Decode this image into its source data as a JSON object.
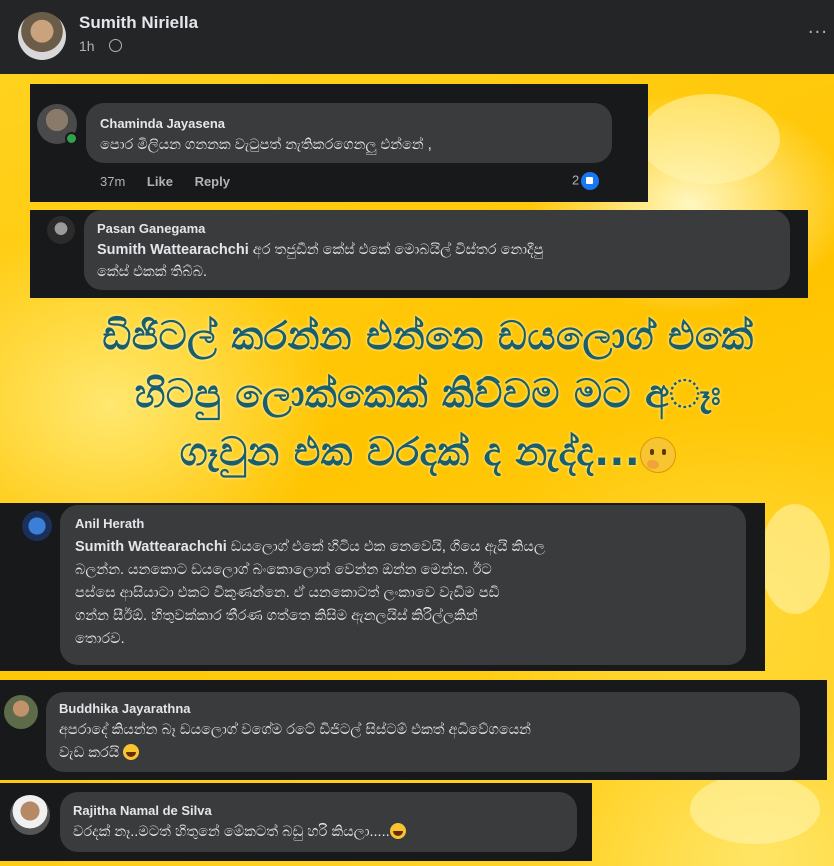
{
  "post": {
    "author": "Sumith Niriella",
    "time": "1h",
    "menu": "···"
  },
  "headline": {
    "line1": "ඩිජිටල් කරන්න එන්නෙ ඩයලොග් එකේ",
    "line2": "හිටපු ලොක්කෙක් කිව්වම මට අෑඃ",
    "line3": "ගෑවුන එක වරදක් ද නැද්ද..."
  },
  "comments": [
    {
      "name": "Chaminda Jayasena",
      "text": "පොර මිලියන ගනනක වැටුපත් නැතිකරගෙනලු එන්නේ ,",
      "time": "37m",
      "like": "Like",
      "reply": "Reply",
      "reactions": "2"
    },
    {
      "name": "Pasan Ganegama",
      "tag": "Sumith Wattearachchi",
      "text_line1": " අර තජුඩීන් කේස් එකේ මොබයිල් විස්තර නොදීපු",
      "text_line2": "කේස් එකක් තිබ්බ."
    },
    {
      "name": "Anil Herath",
      "tag": "Sumith Wattearachchi",
      "text_line1": " ඩයලොග් එකේ හිටිය එක නෙවෙයි, ගියෙ ඇයි කියල",
      "text_line2": "බලන්න. යනකොට ඩයලොග් බංකොලොත් වෙන්න ඔන්න මෙන්න. ඊට",
      "text_line3": "පස්සෙ ආසියාටා එකට විකුණන්නෙ. ඒ යනකොටත් ලංකාවෙ වැඩිම පඩි",
      "text_line4": "ගන්න සීඊඕ. හිතුවක්කාර තීරණ ගත්තෙ කිසිම ඇනලයිස් කිරිල්ලකින්",
      "text_line5": "තොරව."
    },
    {
      "name": "Buddhika Jayarathna",
      "text_line1": "අපරාදේ කියන්න බෑ ඩයලොග් වගේම රටේ ඩිජිටල් සිස්ටම් එකත් අධිවේගයෙන්",
      "text_line2": "වැඩ කරයි"
    },
    {
      "name": "Rajitha Namal de Silva",
      "text": "වරදක් නෑ..මටත් හිතුනේ මේකටත් බඩු හරි කියලා....."
    }
  ],
  "colors": {
    "headline": "#1b5e6b",
    "bubble": "#3a3b3c",
    "panel": "#18191a",
    "like": "#1877f2",
    "background": "#ffc400"
  },
  "icons": {
    "globe": "globe-icon",
    "like": "thumbs-up-icon",
    "think": "thinking-face-emoji",
    "laugh": "laughing-face-emoji"
  }
}
